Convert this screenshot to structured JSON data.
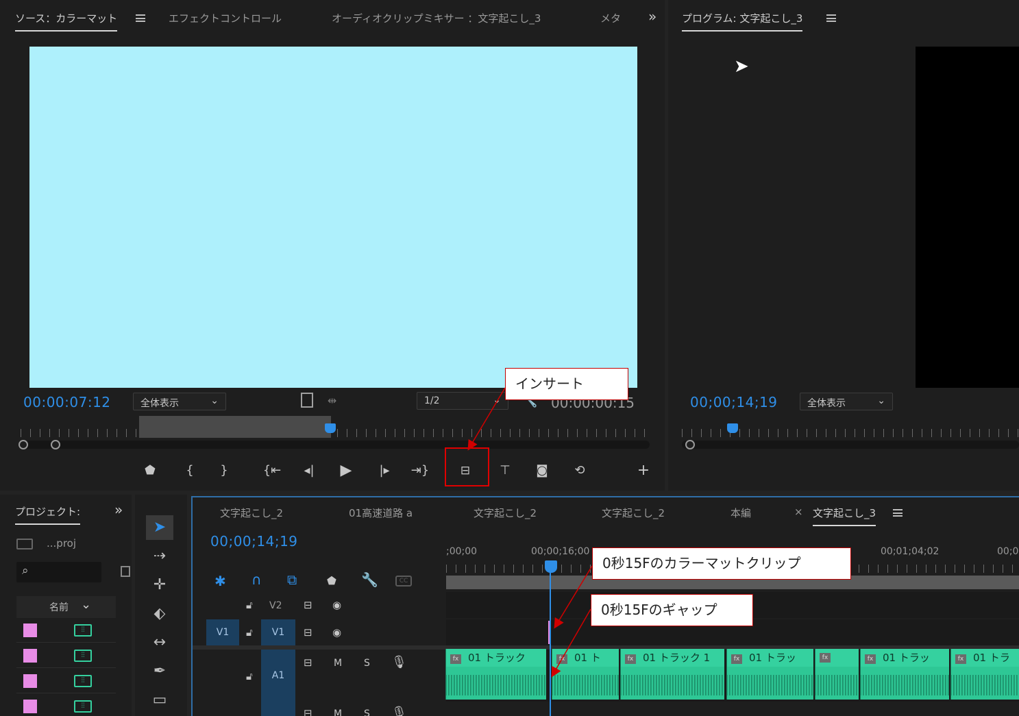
{
  "source_panel": {
    "tabs": [
      "ソース：カラーマット",
      "エフェクトコントロール",
      "オーディオクリップミキサー ：文字起こし_3",
      "メタ"
    ],
    "timecode": "00:00:07:12",
    "fit_label": "全体表示",
    "resolution": "1/2",
    "duration": "00:00:00:15",
    "preview_color": "#aef0fc"
  },
  "program_panel": {
    "title": "プログラム: 文字起こし_3",
    "timecode": "00;00;14;19",
    "fit_label": "全体表示"
  },
  "project_panel": {
    "title": "プロジェクト:",
    "path": "...proj",
    "column_name": "名前"
  },
  "timeline": {
    "tabs": [
      "文字起こし_2",
      "01高速道路 a",
      "文字起こし_2",
      "文字起こし_2",
      "本編",
      "文字起こし_3"
    ],
    "close_mark": "×",
    "timecode": "00;00;14;19",
    "ruler_labels": [
      ";00;00",
      "00;00;16;00",
      "00;01;04;02",
      "00;0"
    ],
    "tracks": {
      "v2": "V2",
      "v1_source": "V1",
      "v1": "V1",
      "a1": "A1",
      "mute": "M",
      "solo": "S"
    },
    "clips": [
      "01 トラック",
      "01 ト",
      "01 トラック 1",
      "01 トラッ",
      "",
      "01 トラッ",
      "01 トラ"
    ]
  },
  "callouts": {
    "insert": "インサート",
    "color_matte_clip": "0秒15Fのカラーマットクリップ",
    "gap": "0秒15Fのギャップ"
  },
  "colors": {
    "accent_blue": "#2f8fe8",
    "audio_clip": "#2ec795",
    "callout_border": "#c00000",
    "color_matte": "#e88ce6"
  }
}
